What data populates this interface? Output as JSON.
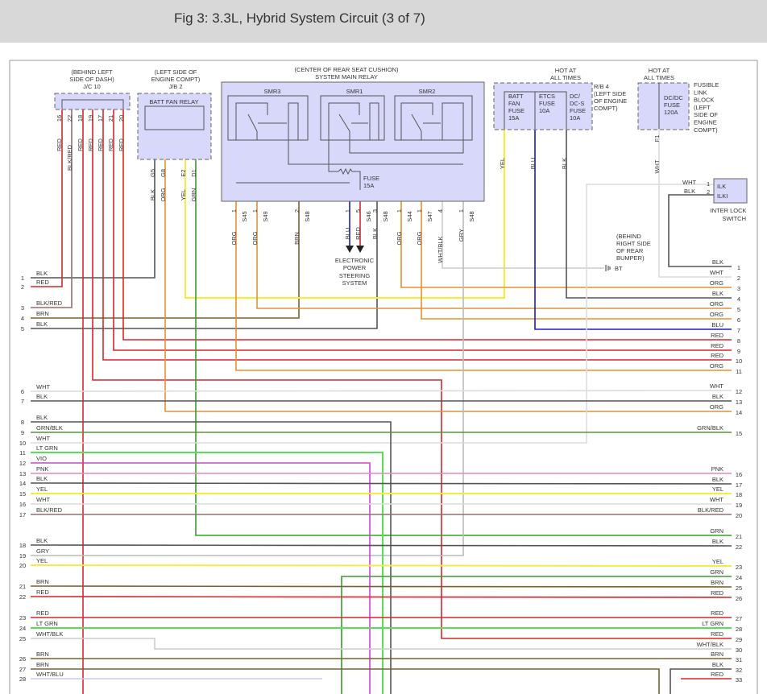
{
  "header": {
    "title": "Fig 3: 3.3L, Hybrid System Circuit (3 of 7)"
  },
  "components": {
    "jc10": {
      "location1": "(BEHIND LEFT",
      "location2": "SIDE OF DASH)",
      "name": "J/C 10"
    },
    "jb2": {
      "location1": "(LEFT SIDE OF",
      "location2": "ENGINE COMPT)",
      "name": "J/B 2",
      "relay": "BATT FAN RELAY"
    },
    "smr": {
      "location": "(CENTER OF REAR SEAT CUSHION)",
      "name": "SYSTEM MAIN RELAY",
      "relays": [
        "SMR3",
        "SMR1",
        "SMR2"
      ],
      "fuse1": "FUSE",
      "fuse2": "15A"
    },
    "rb4": {
      "hot1": "HOT AT",
      "hot2": "ALL TIMES",
      "name_lines": [
        "R/B 4",
        "(LEFT SIDE",
        "OF ENGINE",
        "COMPT)"
      ],
      "fuses": [
        [
          "BATT",
          "FAN",
          "FUSE",
          "15A"
        ],
        [
          "ETCS",
          "FUSE",
          "10A"
        ],
        [
          "DC/",
          "DC-S",
          "FUSE",
          "10A"
        ]
      ]
    },
    "fusible": {
      "hot1": "HOT AT",
      "hot2": "ALL TIMES",
      "fuse": [
        "DC/DC",
        "FUSE",
        "120A"
      ],
      "name_lines": [
        "FUSIBLE",
        "LINK",
        "BLOCK",
        "(LEFT",
        "SIDE OF",
        "ENGINE",
        "COMPT)"
      ]
    },
    "interlock": {
      "pins": [
        "ILK",
        "ILKI"
      ],
      "pin_nums": [
        "1",
        "2"
      ],
      "wires": [
        "WHT",
        "BLK"
      ],
      "name1": "INTER LOCK",
      "name2": "SWITCH"
    },
    "ground": {
      "location": [
        "(BEHIND",
        "RIGHT SIDE",
        "OF REAR",
        "BUMPER)"
      ],
      "name": "BT"
    },
    "eps": {
      "lines": [
        "ELECTRONIC",
        "POWER",
        "STEERING",
        "SYSTEM"
      ]
    }
  },
  "vertical_labels": [
    "16",
    "22",
    "18",
    "19",
    "17",
    "21",
    "20",
    "RED",
    "BLK/RED",
    "RED",
    "RED",
    "RED",
    "RED",
    "RED",
    "G5",
    "G8",
    "E2",
    "D1",
    "BLK",
    "ORG",
    "YEL",
    "GRN",
    "1",
    "S45",
    "1",
    "S49",
    "2",
    "S48",
    "1",
    "5",
    "S46",
    "3",
    "S48",
    "1",
    "S44",
    "1",
    "S47",
    "4",
    "1",
    "S48",
    "ORG",
    "ORG",
    "BRN",
    "BLU",
    "RED",
    "BLK",
    "ORG",
    "ORG",
    "WHT/BLK",
    "GRY",
    "YEL",
    "BLU",
    "BLK",
    "F1",
    "WHT"
  ],
  "left_rows": [
    {
      "num": "1",
      "label": "BLK"
    },
    {
      "num": "2",
      "label": "RED"
    },
    {
      "num": "3",
      "label": "BLK/RED"
    },
    {
      "num": "4",
      "label": "BRN"
    },
    {
      "num": "5",
      "label": "BLK"
    },
    {
      "num": "6",
      "label": "WHT"
    },
    {
      "num": "7",
      "label": "BLK"
    },
    {
      "num": "8",
      "label": "BLK"
    },
    {
      "num": "9",
      "label": "GRN/BLK"
    },
    {
      "num": "10",
      "label": "WHT"
    },
    {
      "num": "11",
      "label": "LT GRN"
    },
    {
      "num": "12",
      "label": "VIO"
    },
    {
      "num": "13",
      "label": "PNK"
    },
    {
      "num": "14",
      "label": "BLK"
    },
    {
      "num": "15",
      "label": "YEL"
    },
    {
      "num": "16",
      "label": "WHT"
    },
    {
      "num": "17",
      "label": "BLK/RED"
    },
    {
      "num": "18",
      "label": "BLK"
    },
    {
      "num": "19",
      "label": "GRY"
    },
    {
      "num": "20",
      "label": "YEL"
    },
    {
      "num": "21",
      "label": "BRN"
    },
    {
      "num": "22",
      "label": "RED"
    },
    {
      "num": "23",
      "label": "RED"
    },
    {
      "num": "24",
      "label": "LT GRN"
    },
    {
      "num": "25",
      "label": "WHT/BLK"
    },
    {
      "num": "26",
      "label": "BRN"
    },
    {
      "num": "27",
      "label": "BRN"
    },
    {
      "num": "28",
      "label": "WHT/BLU"
    }
  ],
  "right_rows": [
    {
      "num": "1",
      "label": "BLK"
    },
    {
      "num": "2",
      "label": "WHT"
    },
    {
      "num": "3",
      "label": "ORG"
    },
    {
      "num": "4",
      "label": "BLK"
    },
    {
      "num": "5",
      "label": "ORG"
    },
    {
      "num": "6",
      "label": "ORG"
    },
    {
      "num": "7",
      "label": "BLU"
    },
    {
      "num": "8",
      "label": "RED"
    },
    {
      "num": "9",
      "label": "RED"
    },
    {
      "num": "10",
      "label": "RED"
    },
    {
      "num": "11",
      "label": "ORG"
    },
    {
      "num": "12",
      "label": "WHT"
    },
    {
      "num": "13",
      "label": "BLK"
    },
    {
      "num": "14",
      "label": "ORG"
    },
    {
      "num": "15",
      "label": "GRN/BLK"
    },
    {
      "num": "16",
      "label": "PNK"
    },
    {
      "num": "17",
      "label": "BLK"
    },
    {
      "num": "18",
      "label": "YEL"
    },
    {
      "num": "19",
      "label": "WHT"
    },
    {
      "num": "20",
      "label": "BLK/RED"
    },
    {
      "num": "21",
      "label": "GRN"
    },
    {
      "num": "22",
      "label": "BLK"
    },
    {
      "num": "23",
      "label": "YEL"
    },
    {
      "num": "24",
      "label": "GRN"
    },
    {
      "num": "25",
      "label": "BRN"
    },
    {
      "num": "26",
      "label": "RED"
    },
    {
      "num": "27",
      "label": "RED"
    },
    {
      "num": "28",
      "label": "LT GRN"
    },
    {
      "num": "29",
      "label": "RED"
    },
    {
      "num": "30",
      "label": "WHT/BLK"
    },
    {
      "num": "31",
      "label": "BRN"
    },
    {
      "num": "32",
      "label": "BLK"
    },
    {
      "num": "33",
      "label": "RED"
    }
  ],
  "wire_colors": {
    "RED": "#d8262a",
    "BLK": "#555555",
    "WHT": "#dcdcdc",
    "ORG": "#e8902e",
    "YEL": "#f4ee3a",
    "GRN": "#3d9a30",
    "LTGRN": "#55e055",
    "BLU": "#1e1ec0",
    "BRN": "#7d6030",
    "VIO": "#d040d0",
    "PNK": "#e488c4",
    "GRY": "#bbbbbb",
    "BLKRED": "#907070",
    "GRNBLK": "#5a9045",
    "WHTBLK": "#cccccc",
    "WHTBLU": "#c8c8f2"
  }
}
